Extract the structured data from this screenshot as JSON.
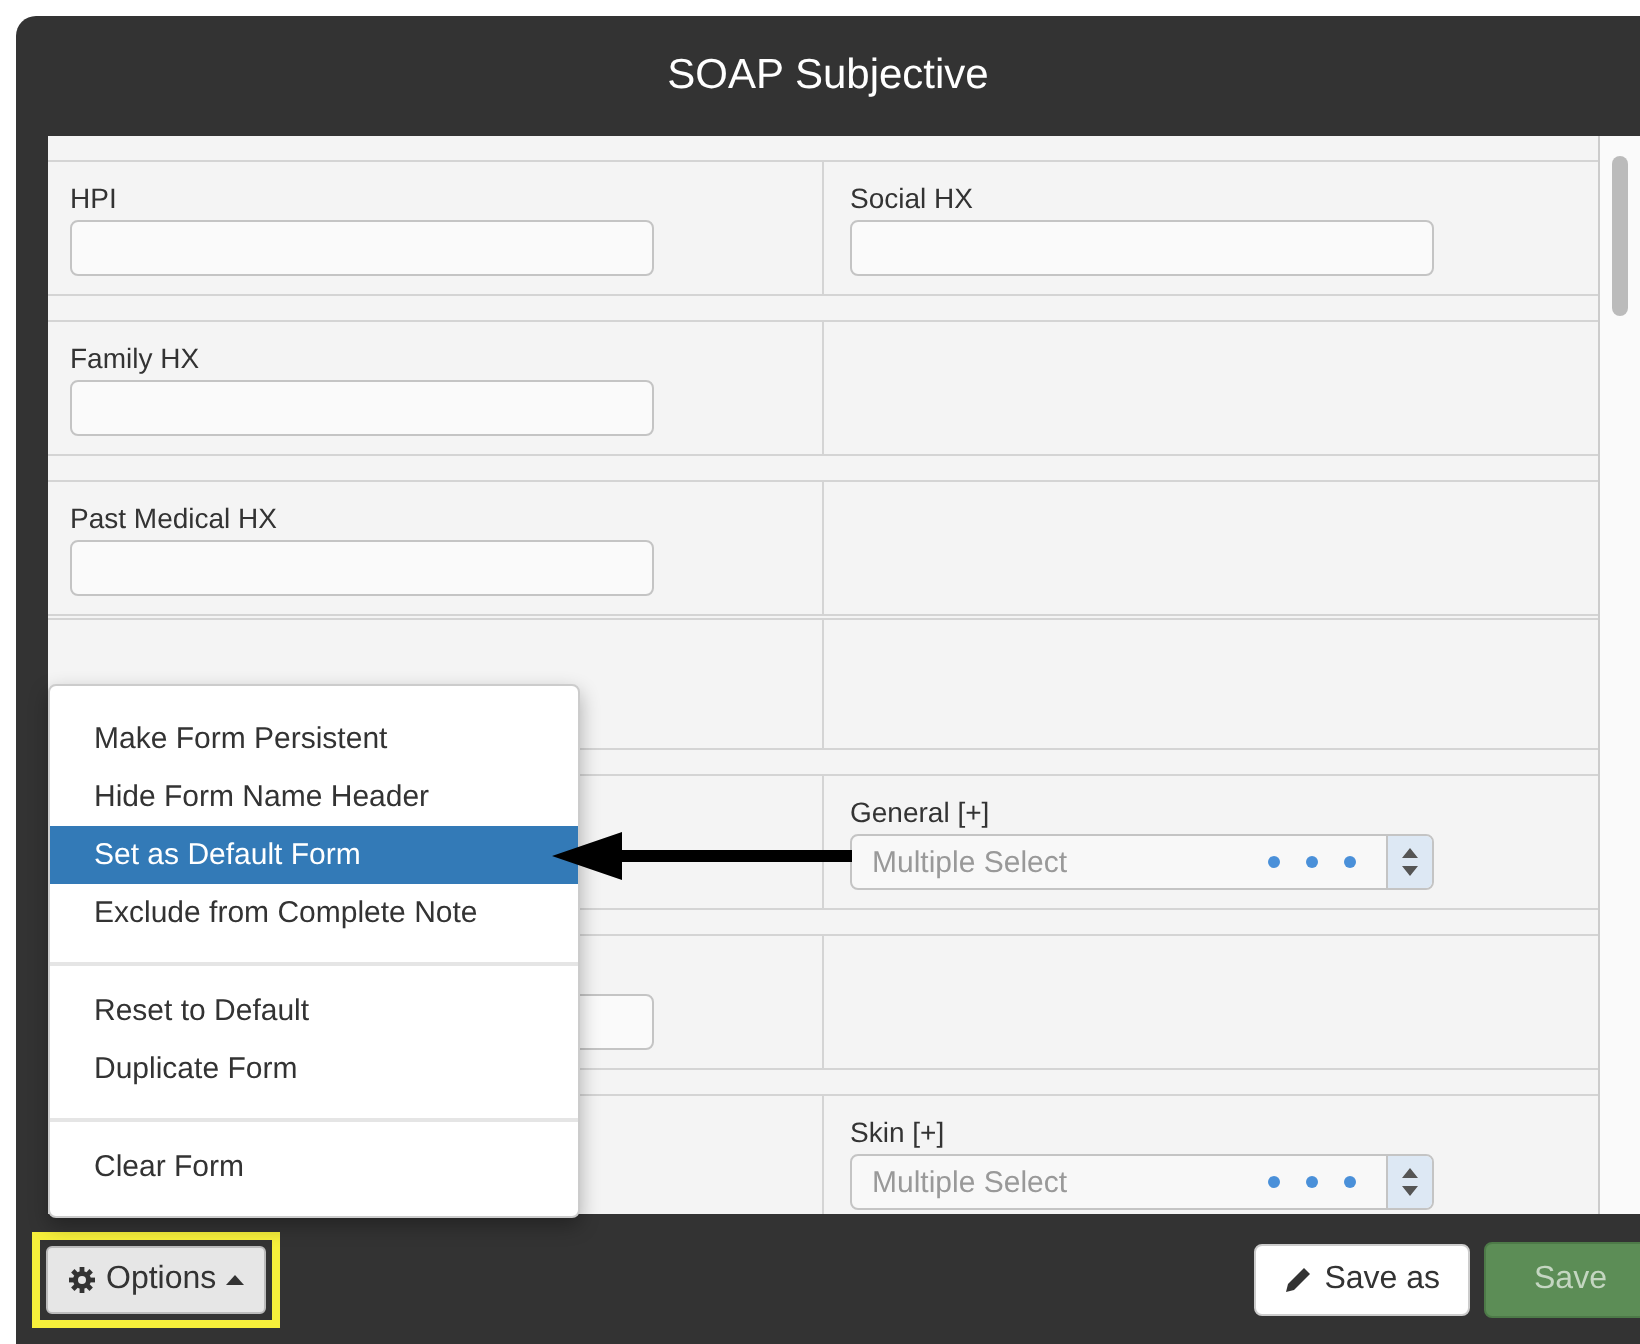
{
  "window": {
    "title": "SOAP Subjective"
  },
  "rows": [
    {
      "cells": [
        {
          "kind": "text",
          "label": "HPI"
        },
        {
          "kind": "text",
          "label": "Social HX"
        }
      ]
    },
    {
      "cells": [
        {
          "kind": "text",
          "label": "Family HX"
        },
        {
          "kind": "empty"
        }
      ]
    },
    {
      "cells": [
        {
          "kind": "text",
          "label": "Past Medical HX"
        },
        {
          "kind": "empty"
        }
      ]
    },
    {
      "cells": [
        {
          "kind": "empty"
        },
        {
          "kind": "empty"
        }
      ]
    },
    {
      "cells": [
        {
          "kind": "empty"
        },
        {
          "kind": "select",
          "label": "General [+]",
          "placeholder": "Multiple Select"
        }
      ]
    },
    {
      "cells": [
        {
          "kind": "text"
        },
        {
          "kind": "empty"
        }
      ]
    },
    {
      "cells": [
        {
          "kind": "empty"
        },
        {
          "kind": "select",
          "label": "Skin [+]",
          "placeholder": "Multiple Select"
        }
      ]
    }
  ],
  "options_menu": {
    "groups": [
      [
        {
          "label": "Make Form Persistent",
          "selected": false
        },
        {
          "label": "Hide Form Name Header",
          "selected": false
        },
        {
          "label": "Set as Default Form",
          "selected": true
        },
        {
          "label": "Exclude from Complete Note",
          "selected": false
        }
      ],
      [
        {
          "label": "Reset to Default",
          "selected": false
        },
        {
          "label": "Duplicate Form",
          "selected": false
        }
      ],
      [
        {
          "label": "Clear Form",
          "selected": false
        }
      ]
    ]
  },
  "footer": {
    "options_button": {
      "label": "Options",
      "highlighted": true
    },
    "save_as_button": {
      "label": "Save as"
    },
    "save_button": {
      "label": "Save",
      "disabled": true
    }
  }
}
